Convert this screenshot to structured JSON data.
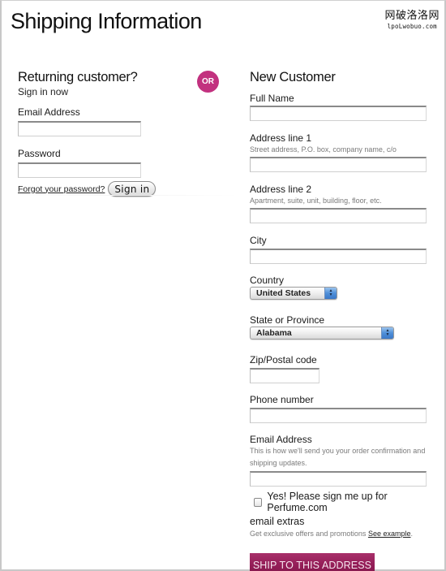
{
  "page": {
    "title": "Shipping Information",
    "watermark": {
      "line1": "网破洛洛网",
      "line2": "lpoLwobuo.com"
    }
  },
  "returning": {
    "heading": "Returning customer?",
    "subheading": "Sign in now",
    "email_label": "Email Address",
    "email_value": "",
    "password_label": "Password",
    "password_value": "",
    "forgot_link": "Forgot your password?",
    "signin_button": "Sign in"
  },
  "or_badge": {
    "label": "OR",
    "color": "#c2317f"
  },
  "new_customer": {
    "heading": "New Customer",
    "fields": {
      "full_name": {
        "label": "Full Name",
        "value": ""
      },
      "address1": {
        "label": "Address line 1",
        "hint": "Street address, P.O. box, company name, c/o",
        "value": ""
      },
      "address2": {
        "label": "Address line 2",
        "hint": "Apartment, suite, unit, building, floor, etc.",
        "value": ""
      },
      "city": {
        "label": "City",
        "value": ""
      },
      "country": {
        "label": "Country",
        "selected": "United States"
      },
      "state": {
        "label": "State or Province",
        "selected": "Alabama"
      },
      "zip": {
        "label": "Zip/Postal code",
        "value": ""
      },
      "phone": {
        "label": "Phone number",
        "value": ""
      },
      "email": {
        "label": "Email Address",
        "hint": "This is how we'll send you your order confirmation and shipping updates.",
        "value": ""
      }
    },
    "newsletter": {
      "checked": false,
      "label_line1": "Yes! Please sign me up for Perfume.com",
      "label_line2": "email extras",
      "hint": "Get exclusive offers and promotions",
      "link": "See example",
      "link_suffix": "."
    },
    "submit_button": "SHIP TO THIS ADDRESS",
    "submit_color": "#931d57"
  }
}
